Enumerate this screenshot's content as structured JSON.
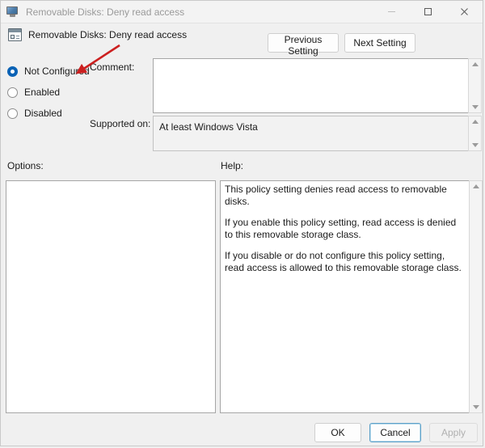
{
  "window": {
    "title": "Removable Disks: Deny read access",
    "icon": "monitor-policy-icon",
    "controls": {
      "minimize": "minimize-icon",
      "maximize": "maximize-icon",
      "close": "close-icon"
    }
  },
  "header": {
    "icon": "policy-setting-icon",
    "title": "Removable Disks: Deny read access",
    "previous_button": "Previous Setting",
    "next_button": "Next Setting"
  },
  "state_options": [
    {
      "label": "Not Configured",
      "selected": true
    },
    {
      "label": "Enabled",
      "selected": false
    },
    {
      "label": "Disabled",
      "selected": false
    }
  ],
  "fields": {
    "comment_label": "Comment:",
    "comment_value": "",
    "supported_label": "Supported on:",
    "supported_value": "At least Windows Vista"
  },
  "panels": {
    "options_label": "Options:",
    "options_value": "",
    "help_label": "Help:",
    "help_paragraphs": [
      "This policy setting denies read access to removable disks.",
      "If you enable this policy setting, read access is denied to this removable storage class.",
      "If you disable or do not configure this policy setting, read access is allowed to this removable storage class."
    ]
  },
  "footer": {
    "ok": "OK",
    "cancel": "Cancel",
    "apply": "Apply"
  },
  "annotation": {
    "type": "red-arrow",
    "points_to": "Not Configured",
    "color": "#cc2020"
  },
  "colors": {
    "dialog_background": "#f0f0f0",
    "titlebar": "#f3f3f3",
    "accent_radio": "#0a62b5",
    "focus_border": "#5ca0c8",
    "annotation_red": "#cc2020"
  }
}
